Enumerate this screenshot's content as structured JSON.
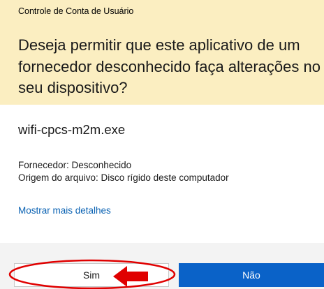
{
  "window": {
    "title": "Controle de Conta de Usuário"
  },
  "prompt": {
    "question": "Deseja permitir que este aplicativo de um fornecedor desconhecido faça alterações no seu dispositivo?"
  },
  "app": {
    "name": "wifi-cpcs-m2m.exe",
    "publisher": "Fornecedor: Desconhecido",
    "origin": "Origem do arquivo: Disco rígido deste computador"
  },
  "links": {
    "more_details": "Mostrar mais detalhes"
  },
  "buttons": {
    "yes": "Sim",
    "no": "Não"
  },
  "colors": {
    "header_background": "#fbeec1",
    "primary_button": "#0a62c8",
    "link": "#0a62b3",
    "annotation": "#e00000"
  }
}
